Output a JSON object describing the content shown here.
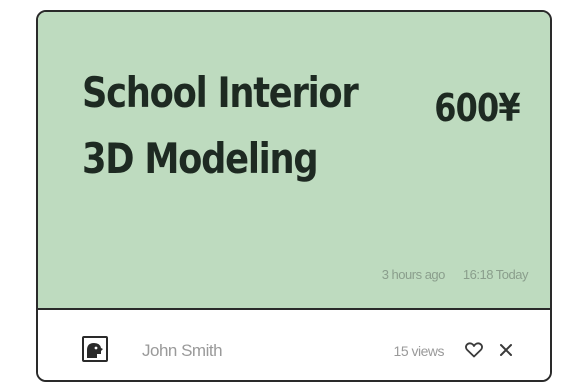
{
  "card": {
    "title_line1": "School Interior",
    "title_line2": "3D Modeling",
    "price": "600¥",
    "posted": "3 hours ago",
    "time": "16:18 Today",
    "author": "John Smith",
    "views": "15 views",
    "icons": {
      "avatar": "avatar-icon",
      "like": "heart-icon",
      "dismiss": "close-icon"
    },
    "colors": {
      "header_bg": "#bedbbf",
      "text_dark": "#1e2a22",
      "muted": "#9a9a9a"
    }
  }
}
